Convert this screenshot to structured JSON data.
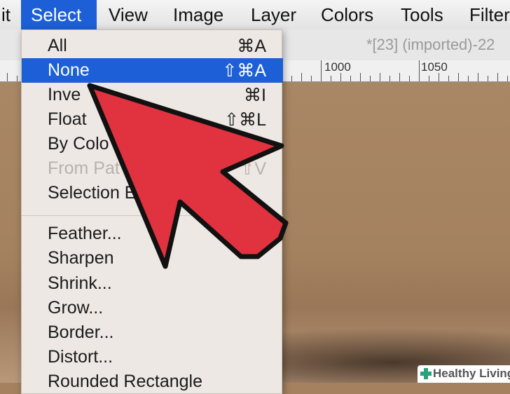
{
  "menubar": {
    "items": [
      "it",
      "Select",
      "View",
      "Image",
      "Layer",
      "Colors",
      "Tools",
      "Filter"
    ]
  },
  "window": {
    "title": "*[23] (imported)-22"
  },
  "ruler": {
    "labels": [
      "1000",
      "1050"
    ]
  },
  "select_menu": {
    "items": [
      {
        "label": "All",
        "shortcut": "⌘A"
      },
      {
        "label": "None",
        "shortcut": "⇧⌘A"
      },
      {
        "label": "Inve",
        "shortcut": "⌘I"
      },
      {
        "label": "Float",
        "shortcut": "⇧⌘L"
      },
      {
        "label": "By Colo",
        "shortcut": ""
      },
      {
        "label": "From Pat",
        "shortcut": "⇧V"
      },
      {
        "label": "Selection E",
        "shortcut": ""
      },
      {
        "label": "Feather...",
        "shortcut": ""
      },
      {
        "label": "Sharpen",
        "shortcut": ""
      },
      {
        "label": "Shrink...",
        "shortcut": ""
      },
      {
        "label": "Grow...",
        "shortcut": ""
      },
      {
        "label": "Border...",
        "shortcut": ""
      },
      {
        "label": "Distort...",
        "shortcut": ""
      },
      {
        "label": "Rounded Rectangle",
        "shortcut": ""
      }
    ]
  },
  "watermark": {
    "text": "Healthy Living"
  },
  "colors": {
    "accent": "#1c5fd6",
    "arrow": "#e0323f"
  }
}
